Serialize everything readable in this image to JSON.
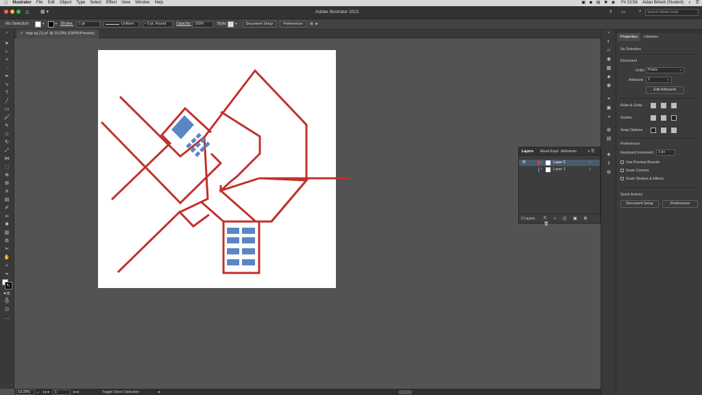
{
  "menubar": {
    "app_name": "Illustrator",
    "items": [
      "File",
      "Edit",
      "Object",
      "Type",
      "Select",
      "Effect",
      "View",
      "Window",
      "Help"
    ],
    "clock": "Fri 13:58",
    "user": "Aidan Birkett (Student)"
  },
  "titlebar": {
    "title": "Adobe Illustrator 2021",
    "search_placeholder": "Search Adobe Help"
  },
  "control_bar": {
    "selection": "No Selection",
    "stroke_label": "Stroke:",
    "stroke_value": "1 pt",
    "profile": "Uniform",
    "brush": "5 pt. Round",
    "opacity_label": "Opacity:",
    "opacity_value": "100%",
    "style_label": "Style:",
    "document_setup": "Document Setup",
    "preferences": "Preferences"
  },
  "document_tab": {
    "title": "map eg (1).ai* @ 19.29% (CMYK/Preview)"
  },
  "status_bar": {
    "zoom": "19.29%",
    "artboard": "1",
    "tool": "Toggle Direct Selection"
  },
  "colors": {
    "stroke_red": "#c0302b",
    "block_blue": "#5b86c5",
    "canvas": "#535353",
    "panel": "#3b3b3b"
  },
  "properties": {
    "tabs": [
      "Properties",
      "Libraries"
    ],
    "active_tab": "Properties",
    "no_selection": "No Selection",
    "document_heading": "Document",
    "units_label": "Units:",
    "units_value": "Pixels",
    "artboard_label": "Artboard:",
    "artboard_value": "1",
    "edit_artboards": "Edit Artboards",
    "ruler_grids": "Ruler & Grids",
    "guides": "Guides",
    "snap_options": "Snap Options",
    "preferences_heading": "Preferences",
    "keyboard_increment_label": "Keyboard Increment:",
    "keyboard_increment_value": "1 px",
    "use_preview_bounds": "Use Preview Bounds",
    "scale_corners": "Scale Corners",
    "scale_strokes": "Scale Strokes & Effects",
    "quick_actions": "Quick Actions",
    "document_setup_btn": "Document Setup",
    "preferences_btn": "Preferences"
  },
  "layers_panel": {
    "tabs": [
      "Layers",
      "Asset Expo",
      "Artboards"
    ],
    "layers": [
      "Layer 2",
      "Layer 1"
    ],
    "layer_colors": [
      "#e0403a",
      "#4a72c8"
    ],
    "count": "2 Layers"
  }
}
